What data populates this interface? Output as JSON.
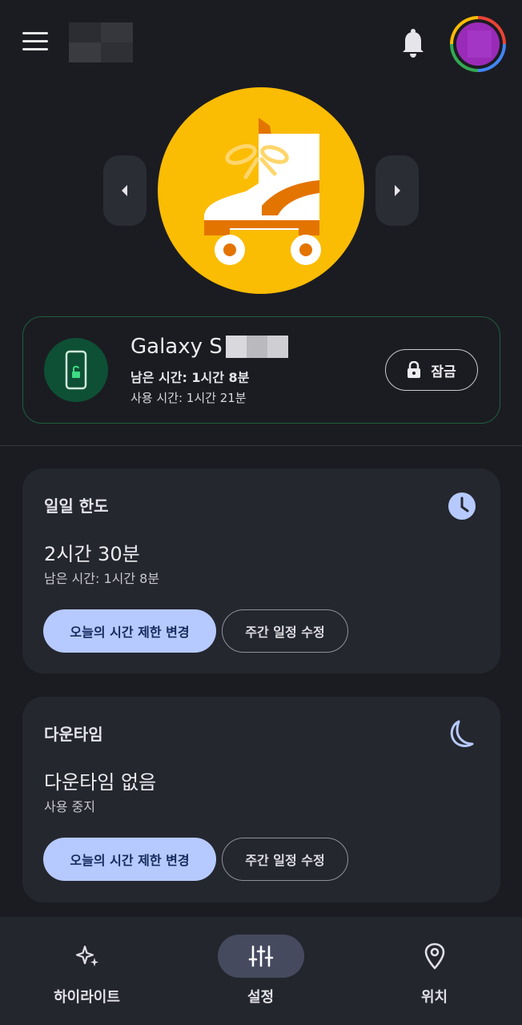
{
  "header": {
    "menu_icon": "menu-icon",
    "notification_icon": "bell-icon"
  },
  "hero": {
    "image": "roller-skate-illustration",
    "prev_icon": "chevron-left-icon",
    "next_icon": "chevron-right-icon",
    "accent_color": "#fbbc04"
  },
  "device": {
    "name_visible": "Galaxy S",
    "remaining": "남은 시간: 1시간 8분",
    "used": "사용 시간: 1시간 21분",
    "lock_label": "잠금",
    "icon": "phone-unlocked-icon",
    "status_color": "#0e5035"
  },
  "daily_limit": {
    "title": "일일 한도",
    "value": "2시간 30분",
    "sub": "남은 시간: 1시간 8분",
    "primary_button": "오늘의 시간 제한 변경",
    "secondary_button": "주간 일정 수정",
    "icon": "clock-icon"
  },
  "downtime": {
    "title": "다운타임",
    "value": "다운타임 없음",
    "sub": "사용 중지",
    "primary_button": "오늘의 시간 제한 변경",
    "secondary_button": "주간 일정 수정",
    "icon": "moon-icon"
  },
  "bottom_nav": {
    "items": [
      {
        "label": "하이라이트",
        "icon": "sparkle-icon"
      },
      {
        "label": "설정",
        "icon": "sliders-icon",
        "active": true
      },
      {
        "label": "위치",
        "icon": "location-pin-icon"
      }
    ]
  }
}
